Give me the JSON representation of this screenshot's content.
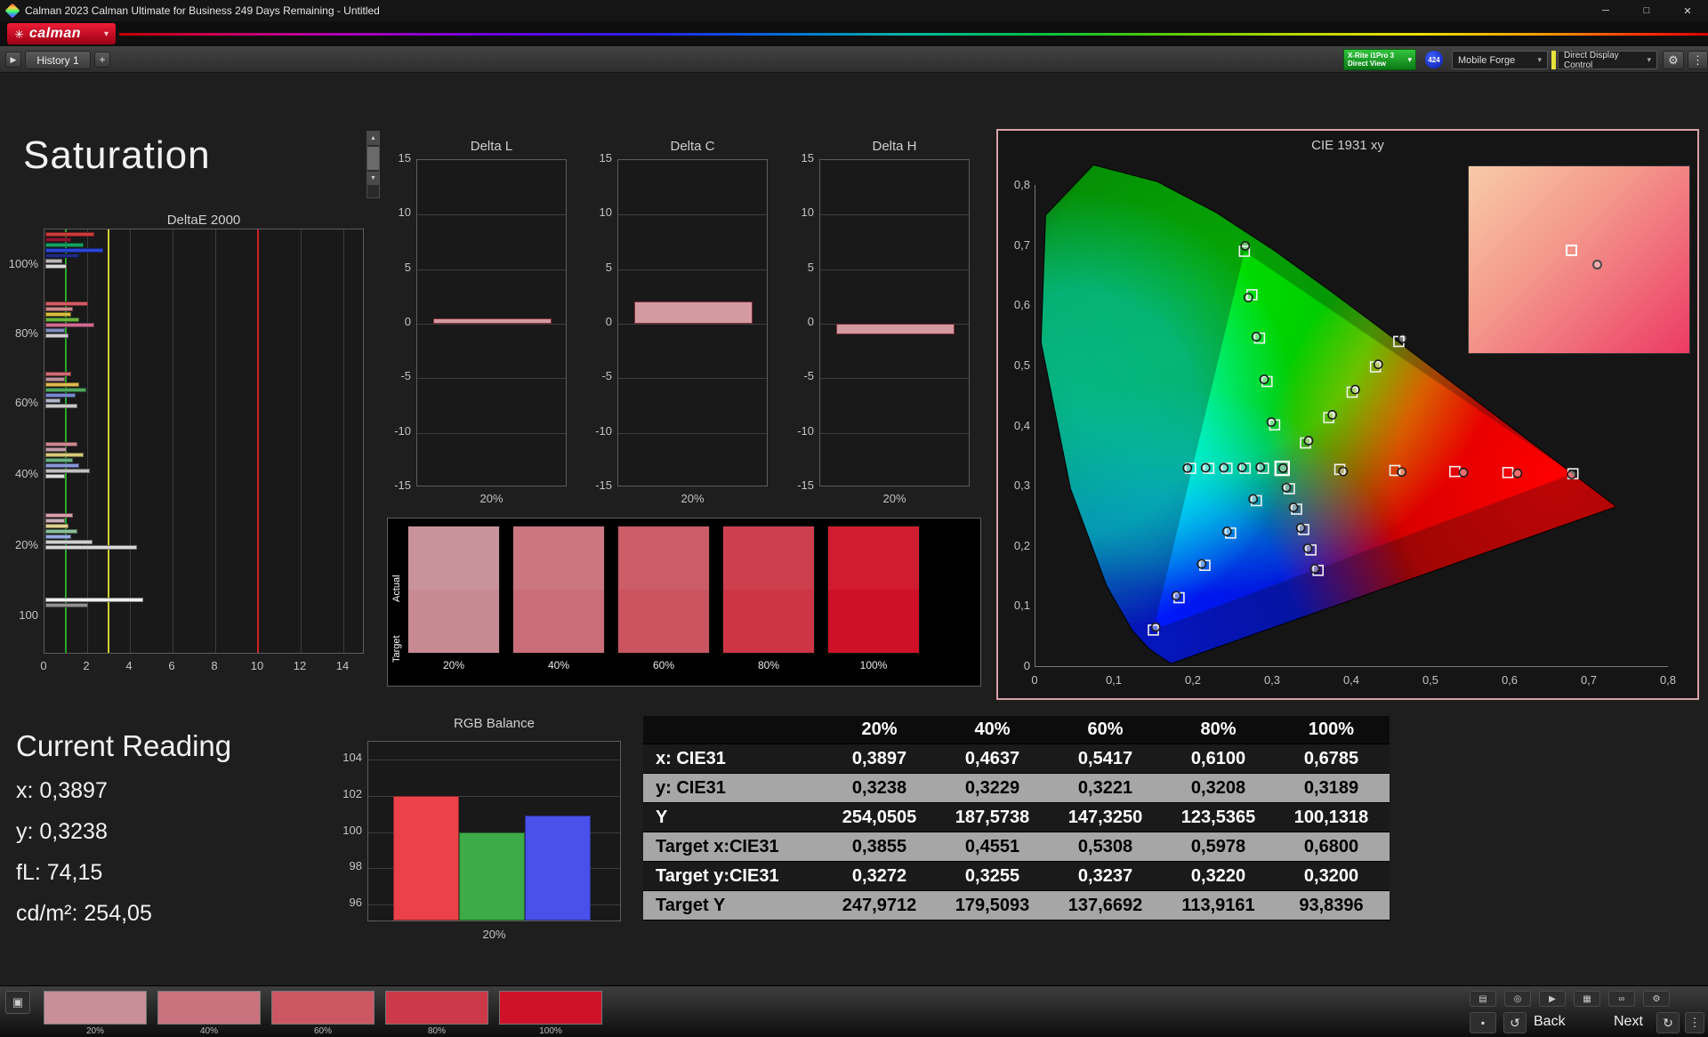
{
  "window": {
    "title": "Calman 2023 Calman Ultimate for Business 249 Days Remaining  - Untitled"
  },
  "icons": {
    "minimize": "─",
    "maximize": "□",
    "close": "✕",
    "caret": "▾",
    "logo_gear": "✳",
    "play": "▶",
    "add": "+",
    "gear": "⚙",
    "menu": "⋮",
    "up": "▲",
    "down": "▼",
    "stop": "▪",
    "back_loop": "↺",
    "next_loop": "↻",
    "meter": "▣",
    "tool_display": "▤",
    "tool_power": "◎",
    "tool_play": "▶",
    "tool_pattern": "▦",
    "tool_link": "∞",
    "tool_gear": "⚙"
  },
  "brand": {
    "logo_text": "calman"
  },
  "toolbar": {
    "history_tab": "History 1",
    "meter_line1": "X-Rite i1Pro 3",
    "meter_line2": "Direct View",
    "badge": "424",
    "pattern_source": "Mobile Forge",
    "display_control": "Direct Display Control"
  },
  "page_title": "Saturation",
  "deltae": {
    "title": "DeltaE 2000",
    "x_ticks": [
      "0",
      "2",
      "4",
      "6",
      "8",
      "10",
      "12",
      "14"
    ],
    "x_max": 15,
    "y_labels": [
      "100%",
      "80%",
      "60%",
      "40%",
      "20%",
      "100"
    ],
    "y_fracs": [
      0.085,
      0.249,
      0.413,
      0.579,
      0.747,
      0.913
    ],
    "ref_lines": [
      {
        "value": 1,
        "color": "#28a828"
      },
      {
        "value": 3,
        "color": "#cfcf30"
      },
      {
        "value": 10,
        "color": "#cc2222"
      }
    ],
    "groups": [
      {
        "label": "100%",
        "bars": [
          [
            "#d03a3a",
            2.3
          ],
          [
            "#8a1530",
            1.2
          ],
          [
            "#15a060",
            1.8
          ],
          [
            "#2a46d8",
            2.7
          ],
          [
            "#202a80",
            1.6
          ],
          [
            "#b8b8b8",
            0.8
          ],
          [
            "#d8d8d8",
            1.0
          ]
        ]
      },
      {
        "label": "80%",
        "bars": [
          [
            "#d45a64",
            2.0
          ],
          [
            "#cc8888",
            1.3
          ],
          [
            "#d8c040",
            1.2
          ],
          [
            "#6ab440",
            1.6
          ],
          [
            "#d06a90",
            2.3
          ],
          [
            "#8090c0",
            0.9
          ],
          [
            "#cccccc",
            1.1
          ]
        ]
      },
      {
        "label": "60%",
        "bars": [
          [
            "#d06a74",
            1.2
          ],
          [
            "#c09098",
            0.9
          ],
          [
            "#e0b850",
            1.6
          ],
          [
            "#50a860",
            1.9
          ],
          [
            "#7888d0",
            1.4
          ],
          [
            "#b0b8c8",
            0.7
          ],
          [
            "#c8c8c8",
            1.5
          ]
        ]
      },
      {
        "label": "40%",
        "bars": [
          [
            "#d08890",
            1.5
          ],
          [
            "#c49aa4",
            1.0
          ],
          [
            "#d8c878",
            1.8
          ],
          [
            "#68b080",
            1.3
          ],
          [
            "#8898d8",
            1.6
          ],
          [
            "#c0c0c0",
            2.1
          ],
          [
            "#dddddd",
            0.9
          ]
        ]
      },
      {
        "label": "20%",
        "bars": [
          [
            "#d8a0aa",
            1.3
          ],
          [
            "#ccb0b8",
            0.9
          ],
          [
            "#e0d090",
            1.1
          ],
          [
            "#88c098",
            1.5
          ],
          [
            "#98a8e0",
            1.2
          ],
          [
            "#d0d0d0",
            2.2
          ],
          [
            "#d8d8d8",
            4.3
          ]
        ]
      },
      {
        "label": "100",
        "bars": [
          [
            "#f0f0f0",
            4.6
          ],
          [
            "#909090",
            2.0
          ]
        ]
      }
    ]
  },
  "delta_axis": {
    "ticks": [
      "15",
      "10",
      "5",
      "0",
      "-5",
      "-10",
      "-15"
    ],
    "min": -15,
    "max": 15
  },
  "delta_charts": [
    {
      "title": "Delta L",
      "x_label": "20%",
      "value": 0.5
    },
    {
      "title": "Delta C",
      "x_label": "20%",
      "value": 2.0
    },
    {
      "title": "Delta H",
      "x_label": "20%",
      "value": -1.0
    }
  ],
  "swatch_panel": {
    "row_labels": [
      "Actual",
      "Target"
    ],
    "swatches": [
      {
        "label": "20%",
        "actual": "#c9939b",
        "target": "#c78a93"
      },
      {
        "label": "40%",
        "actual": "#cb7681",
        "target": "#c96e79"
      },
      {
        "label": "60%",
        "actual": "#cc5d69",
        "target": "#cb5461"
      },
      {
        "label": "80%",
        "actual": "#ce3f4e",
        "target": "#cd3545"
      },
      {
        "label": "100%",
        "actual": "#d01c2e",
        "target": "#cf1128"
      }
    ]
  },
  "cie": {
    "title": "CIE 1931 xy",
    "x_ticks": [
      "0",
      "0,1",
      "0,2",
      "0,3",
      "0,4",
      "0,5",
      "0,6",
      "0,7",
      "0,8"
    ],
    "y_ticks": [
      "0,8",
      "0,7",
      "0,6",
      "0,5",
      "0,4",
      "0,3",
      "0,2",
      "0,1",
      "0"
    ],
    "white_point": {
      "target": [
        0.3127,
        0.329
      ],
      "measured": [
        0.3138,
        0.3292
      ]
    },
    "sweeps": [
      {
        "name": "red",
        "targets": [
          [
            0.3855,
            0.3272
          ],
          [
            0.4551,
            0.3255
          ],
          [
            0.5308,
            0.3237
          ],
          [
            0.5978,
            0.322
          ],
          [
            0.68,
            0.32
          ]
        ],
        "measured": [
          [
            0.3897,
            0.3238
          ],
          [
            0.4637,
            0.3229
          ],
          [
            0.5417,
            0.3221
          ],
          [
            0.61,
            0.3208
          ],
          [
            0.6785,
            0.3189
          ]
        ]
      },
      {
        "name": "green",
        "targets": [
          [
            0.3032,
            0.4012
          ],
          [
            0.2936,
            0.4734
          ],
          [
            0.2841,
            0.5456
          ],
          [
            0.2745,
            0.6178
          ],
          [
            0.265,
            0.69
          ]
        ],
        "measured": [
          [
            0.299,
            0.406
          ],
          [
            0.29,
            0.477
          ],
          [
            0.28,
            0.548
          ],
          [
            0.27,
            0.613
          ],
          [
            0.266,
            0.699
          ]
        ]
      },
      {
        "name": "blue",
        "targets": [
          [
            0.2802,
            0.2752
          ],
          [
            0.2476,
            0.2214
          ],
          [
            0.2151,
            0.1676
          ],
          [
            0.1825,
            0.1138
          ],
          [
            0.15,
            0.06
          ]
        ],
        "measured": [
          [
            0.276,
            0.278
          ],
          [
            0.243,
            0.224
          ],
          [
            0.211,
            0.17
          ],
          [
            0.179,
            0.117
          ],
          [
            0.153,
            0.065
          ]
        ]
      },
      {
        "name": "cyan",
        "targets": [
          [
            0.289,
            0.329
          ],
          [
            0.266,
            0.329
          ],
          [
            0.243,
            0.329
          ],
          [
            0.22,
            0.329
          ],
          [
            0.197,
            0.329
          ]
        ],
        "measured": [
          [
            0.285,
            0.331
          ],
          [
            0.262,
            0.3305
          ],
          [
            0.239,
            0.33
          ],
          [
            0.216,
            0.33
          ],
          [
            0.193,
            0.3295
          ]
        ]
      },
      {
        "name": "magenta",
        "targets": [
          [
            0.3218,
            0.2951
          ],
          [
            0.3309,
            0.2611
          ],
          [
            0.3399,
            0.2272
          ],
          [
            0.349,
            0.1932
          ],
          [
            0.3581,
            0.1593
          ]
        ],
        "measured": [
          [
            0.318,
            0.297
          ],
          [
            0.327,
            0.264
          ],
          [
            0.336,
            0.23
          ],
          [
            0.345,
            0.196
          ],
          [
            0.354,
            0.162
          ]
        ]
      },
      {
        "name": "yellow",
        "targets": [
          [
            0.3422,
            0.3712
          ],
          [
            0.3716,
            0.4134
          ],
          [
            0.4011,
            0.4556
          ],
          [
            0.4305,
            0.4978
          ],
          [
            0.46,
            0.54
          ]
        ],
        "measured": [
          [
            0.346,
            0.375
          ],
          [
            0.376,
            0.418
          ],
          [
            0.405,
            0.46
          ],
          [
            0.434,
            0.502
          ],
          [
            0.465,
            0.545
          ]
        ]
      }
    ],
    "inset": {
      "square": [
        0.44,
        0.42
      ],
      "circle": [
        0.56,
        0.5
      ]
    }
  },
  "current_reading": {
    "title": "Current Reading",
    "lines": [
      "x: 0,3897",
      "y: 0,3238",
      "fL: 74,15",
      "cd/m²: 254,05"
    ]
  },
  "rgb": {
    "title": "RGB Balance",
    "x_label": "20%",
    "y_ticks": [
      "104",
      "102",
      "100",
      "98",
      "96"
    ],
    "y_min": 95,
    "y_max": 105,
    "bars": [
      {
        "name": "red",
        "color": "#ea4248",
        "value": 101.9
      },
      {
        "name": "green",
        "color": "#3dab47",
        "value": 99.9
      },
      {
        "name": "blue",
        "color": "#4a50ea",
        "value": 100.8
      }
    ]
  },
  "table": {
    "headers": [
      "20%",
      "40%",
      "60%",
      "80%",
      "100%"
    ],
    "rows": [
      {
        "label": "x: CIE31",
        "shade": "dark",
        "values": [
          "0,3897",
          "0,4637",
          "0,5417",
          "0,6100",
          "0,6785"
        ]
      },
      {
        "label": "y: CIE31",
        "shade": "light",
        "values": [
          "0,3238",
          "0,3229",
          "0,3221",
          "0,3208",
          "0,3189"
        ]
      },
      {
        "label": "Y",
        "shade": "dark",
        "values": [
          "254,0505",
          "187,5738",
          "147,3250",
          "123,5365",
          "100,1318"
        ]
      },
      {
        "label": "Target x:CIE31",
        "shade": "light",
        "values": [
          "0,3855",
          "0,4551",
          "0,5308",
          "0,5978",
          "0,6800"
        ]
      },
      {
        "label": "Target y:CIE31",
        "shade": "dark",
        "values": [
          "0,3272",
          "0,3255",
          "0,3237",
          "0,3220",
          "0,3200"
        ]
      },
      {
        "label": "Target Y",
        "shade": "light",
        "values": [
          "247,9712",
          "179,5093",
          "137,6692",
          "113,9161",
          "93,8396"
        ]
      }
    ]
  },
  "bottom": {
    "swatches": [
      {
        "label": "20%",
        "color": "#c98f98"
      },
      {
        "label": "40%",
        "color": "#ca737e"
      },
      {
        "label": "60%",
        "color": "#cb5763"
      },
      {
        "label": "80%",
        "color": "#cc3948"
      },
      {
        "label": "100%",
        "color": "#ce1227"
      }
    ],
    "back_label": "Back",
    "next_label": "Next"
  }
}
